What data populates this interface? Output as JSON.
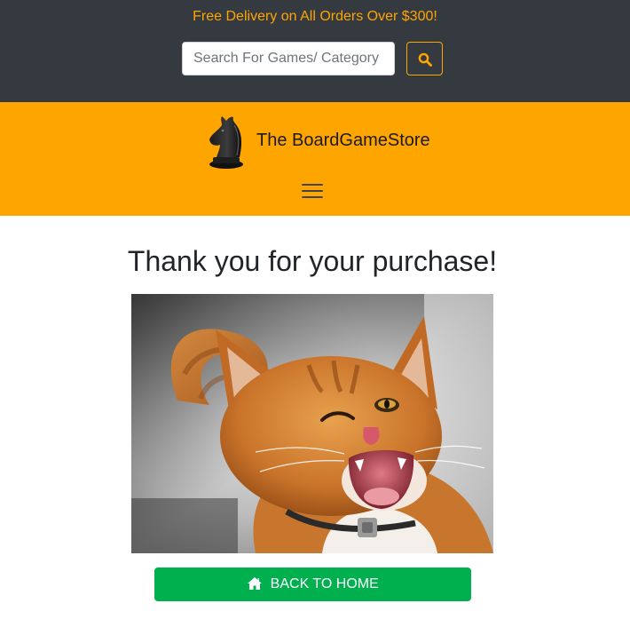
{
  "topbar": {
    "promo_text": "Free Delivery on All Orders Over $300!",
    "search": {
      "placeholder": "Search For Games/ Category",
      "value": ""
    },
    "search_icon": "search-icon"
  },
  "brand": {
    "name": "The BoardGameStore",
    "logo_icon": "chess-knight-icon",
    "menu_icon": "hamburger-menu-icon"
  },
  "main": {
    "heading": "Thank you for your purchase!",
    "image": "winking-cat-photo",
    "home_button": {
      "label": "BACK TO HOME",
      "icon": "home-icon"
    }
  },
  "colors": {
    "topbar_bg": "#343a40",
    "accent_orange": "#ffa500",
    "button_green": "#00b04f"
  }
}
